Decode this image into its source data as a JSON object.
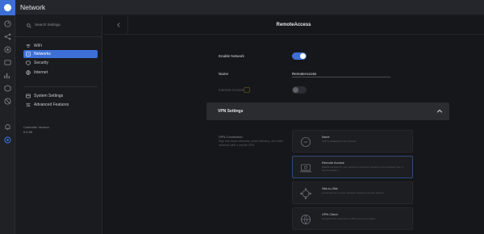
{
  "app": {
    "title": "Network"
  },
  "search": {
    "placeholder": "Search Settings"
  },
  "sidebar": {
    "items": [
      {
        "label": "WiFi",
        "icon": "wifi-icon",
        "active": false
      },
      {
        "label": "Networks",
        "icon": "networks-icon",
        "active": true
      },
      {
        "label": "Security",
        "icon": "shield-icon",
        "active": false
      },
      {
        "label": "Internet",
        "icon": "globe-icon",
        "active": false
      }
    ],
    "items2": [
      {
        "label": "System Settings",
        "icon": "system-settings-icon"
      },
      {
        "label": "Advanced Features",
        "icon": "advanced-features-icon"
      }
    ],
    "controller_label": "Controller Version",
    "controller_version": "6.5.55"
  },
  "main": {
    "title": "RemoteAccess",
    "enable_network_label": "Enable Network",
    "enable_network_on": true,
    "name_label": "Name",
    "name_value": "RemoteAccess",
    "internet_access_label": "Internet Access",
    "internet_access_badge": "",
    "internet_access_on": false,
    "vpn_settings_label": "VPN Settings",
    "vpn_connection_title": "VPN Connection",
    "vpn_connection_desc": "Sign into home networks, share directory, and other networks with a remote VPN.",
    "cards": [
      {
        "title": "None",
        "desc": "VPN is disabled for this network.",
        "icon": "none-icon",
        "selected": false
      },
      {
        "title": "Remote Access",
        "desc": "Enables access for your devices to securely connect to your network from a remote location.",
        "icon": "remote-access-icon",
        "selected": true
      },
      {
        "title": "Site-to-Site",
        "desc": "Connects two or more networks securely over the internet.",
        "icon": "site-to-site-icon",
        "selected": false
      },
      {
        "title": "VPN Client",
        "desc": "Connects this network to a VPN server as a client.",
        "icon": "vpn-client-icon",
        "selected": false
      }
    ]
  },
  "colors": {
    "accent": "#3d6fd6",
    "background": "#121316"
  }
}
